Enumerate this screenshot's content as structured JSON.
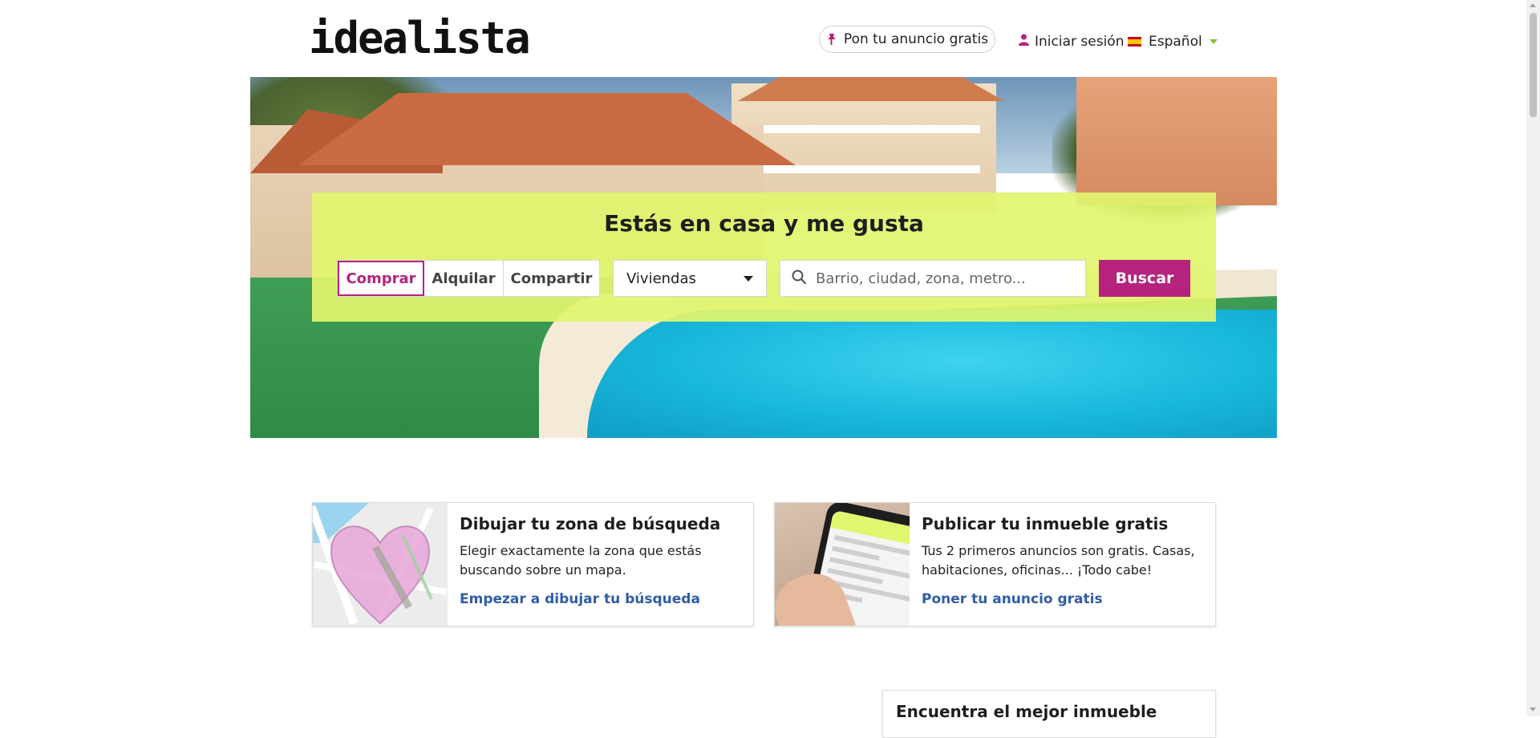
{
  "header": {
    "logo": "idealista",
    "publish_label": "Pon tu anuncio gratis",
    "login_label": "Iniciar sesión",
    "language_label": "Español"
  },
  "hero": {
    "title": "Estás en casa y me gusta",
    "operation_tabs": [
      {
        "label": "Comprar",
        "active": true
      },
      {
        "label": "Alquilar",
        "active": false
      },
      {
        "label": "Compartir",
        "active": false
      }
    ],
    "property_type": "Viviendas",
    "search_placeholder": "Barrio, ciudad, zona, metro...",
    "search_button": "Buscar"
  },
  "cards": [
    {
      "title": "Dibujar tu zona de búsqueda",
      "description": "Elegir exactamente la zona que estás buscando sobre un mapa.",
      "link": "Empezar a dibujar tu búsqueda"
    },
    {
      "title": "Publicar tu inmueble gratis",
      "description": "Tus 2 primeros anuncios son gratis. Casas, habitaciones, oficinas... ¡Todo cabe!",
      "link": "Poner tu anuncio gratis"
    }
  ],
  "bottom_card": {
    "title": "Encuentra el mejor inmueble"
  },
  "colors": {
    "brand": "#b5237f",
    "search_box_bg": "#e1f56e",
    "link": "#2f5da8"
  },
  "icons": {
    "publish": "pin-icon",
    "login": "user-icon",
    "language": "spain-flag-icon",
    "search": "search-icon"
  }
}
